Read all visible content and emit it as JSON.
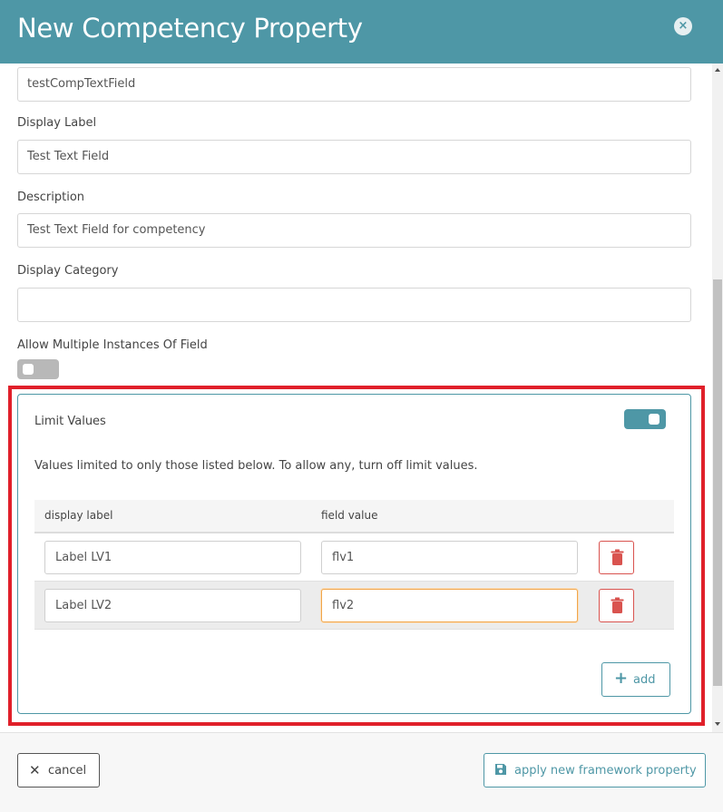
{
  "modal": {
    "title": "New Competency Property",
    "close_glyph": "×"
  },
  "fields": {
    "property_name_value": "testCompTextField",
    "display_label": {
      "label": "Display Label",
      "value": "Test Text Field"
    },
    "description": {
      "label": "Description",
      "value": "Test Text Field for competency"
    },
    "display_category": {
      "label": "Display Category",
      "value": ""
    },
    "allow_multiple": {
      "label": "Allow Multiple Instances Of Field",
      "on": false
    }
  },
  "limit_values": {
    "title": "Limit Values",
    "on": true,
    "description": "Values limited to only those listed below. To allow any, turn off limit values.",
    "columns": [
      "display label",
      "field value"
    ],
    "rows": [
      {
        "display_label": "Label LV1",
        "field_value": "flv1"
      },
      {
        "display_label": "Label LV2",
        "field_value": "flv2"
      }
    ],
    "add_label": "add"
  },
  "footer": {
    "cancel_label": "cancel",
    "apply_label": "apply new framework property"
  },
  "colors": {
    "header": "#4e97a6",
    "accent": "#4e97a6",
    "danger": "#d9534f",
    "highlight": "#e0202a",
    "focus": "#f0a54a"
  },
  "icons": {
    "close": "close-icon",
    "delete": "trash-icon",
    "add": "plus-icon",
    "cancel": "x-icon",
    "apply": "save-icon"
  }
}
